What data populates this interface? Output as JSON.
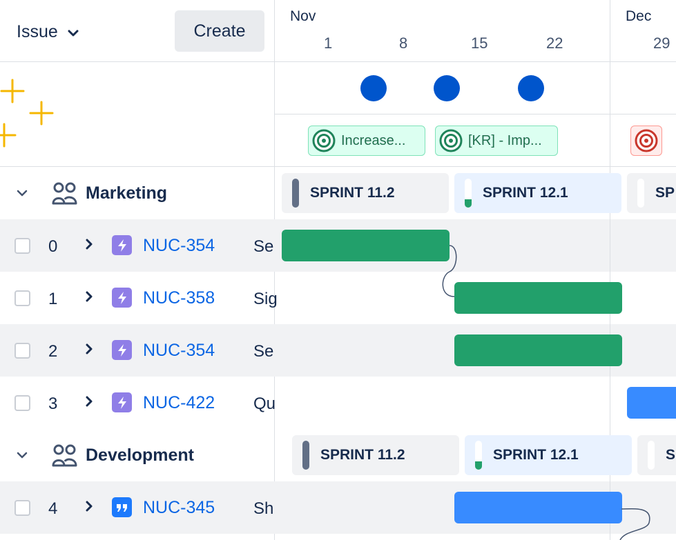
{
  "header": {
    "issue_label": "Issue",
    "create_label": "Create"
  },
  "timeline": {
    "months": [
      {
        "label": "Nov"
      },
      {
        "label": "Dec"
      }
    ],
    "days": [
      "1",
      "8",
      "15",
      "22",
      "29"
    ]
  },
  "goals": [
    {
      "label": "Increase...",
      "status": "on-track"
    },
    {
      "label": "[KR] - Imp...",
      "status": "on-track"
    },
    {
      "label": "",
      "status": "off-track"
    }
  ],
  "groups": [
    {
      "name": "Marketing",
      "sprints": [
        "SPRINT 11.2",
        "SPRINT 12.1",
        "SP"
      ]
    },
    {
      "name": "Development",
      "sprints": [
        "SPRINT 11.2",
        "SPRINT 12.1",
        "S"
      ]
    }
  ],
  "rows": [
    {
      "num": "0",
      "key": "NUC-354",
      "summary": "Se",
      "type": "epic"
    },
    {
      "num": "1",
      "key": "NUC-358",
      "summary": "Sig",
      "type": "epic"
    },
    {
      "num": "2",
      "key": "NUC-354",
      "summary": "Se",
      "type": "epic"
    },
    {
      "num": "3",
      "key": "NUC-422",
      "summary": "Qu",
      "type": "epic"
    },
    {
      "num": "4",
      "key": "NUC-345",
      "summary": "Sh",
      "type": "story"
    }
  ],
  "colors": {
    "green_bar": "#22A06B",
    "blue_bar": "#388BFF",
    "milestone": "#0055CC",
    "link": "#0C66E4",
    "epic_icon": "#8F7EE7",
    "story_icon": "#1D7AFC",
    "sparkle": "#F5B700"
  }
}
